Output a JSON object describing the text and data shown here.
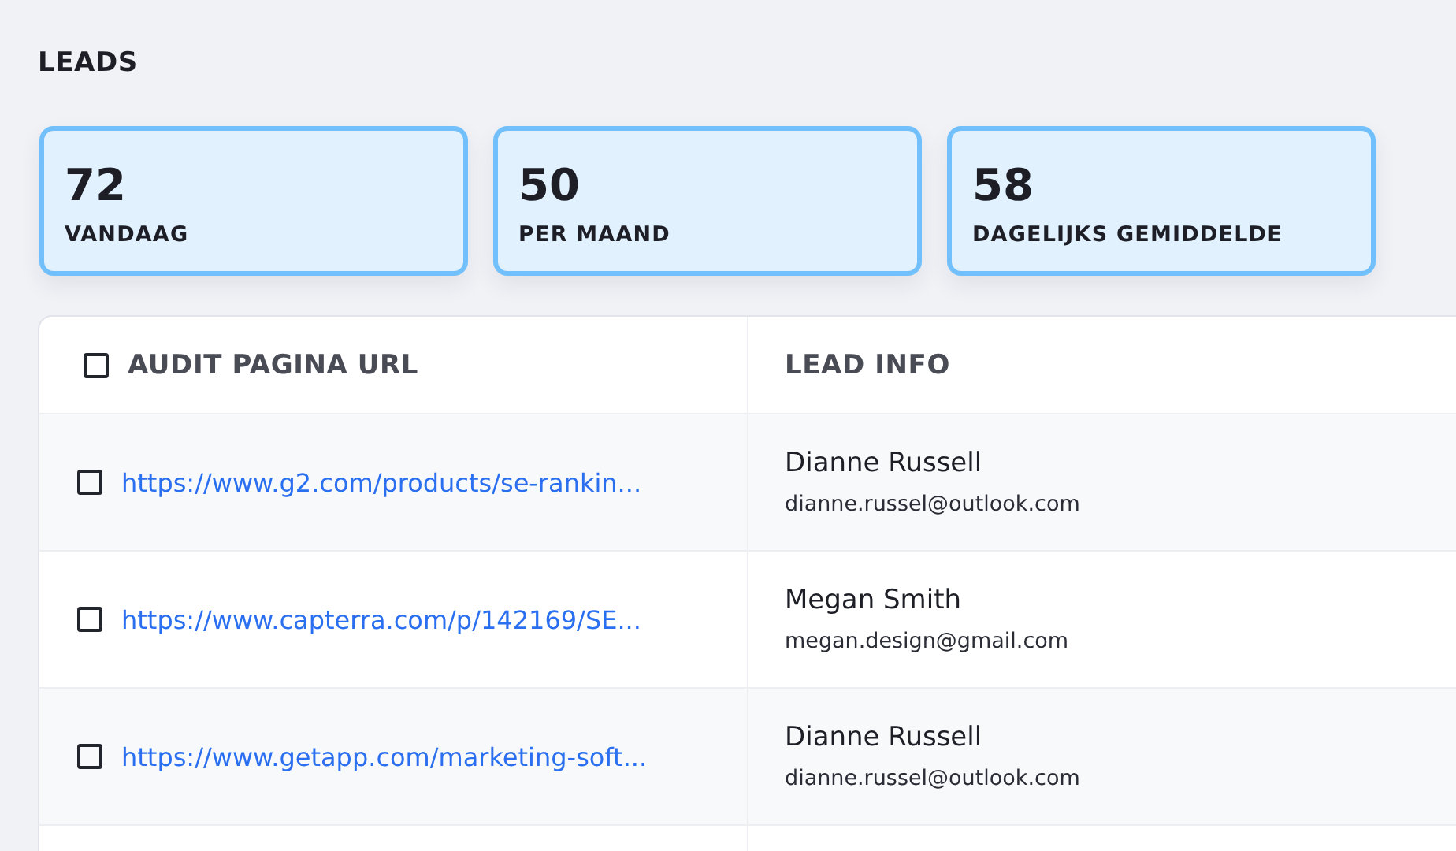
{
  "title": "LEADS",
  "stats": [
    {
      "value": "72",
      "label": "VANDAAG"
    },
    {
      "value": "50",
      "label": "PER MAAND"
    },
    {
      "value": "58",
      "label": "DAGELIJKS GEMIDDELDE"
    }
  ],
  "table": {
    "header_checked": false,
    "columns": [
      "AUDIT PAGINA URL",
      "LEAD INFO"
    ],
    "rows": [
      {
        "checked": false,
        "url": "https://www.g2.com/products/se-rankin...",
        "name": "Dianne Russell",
        "email": "dianne.russel@outlook.com"
      },
      {
        "checked": false,
        "url": "https://www.capterra.com/p/142169/SE...",
        "name": "Megan Smith",
        "email": "megan.design@gmail.com"
      },
      {
        "checked": false,
        "url": "https://www.getapp.com/marketing-soft...",
        "name": "Dianne Russell",
        "email": "dianne.russel@outlook.com"
      }
    ]
  }
}
